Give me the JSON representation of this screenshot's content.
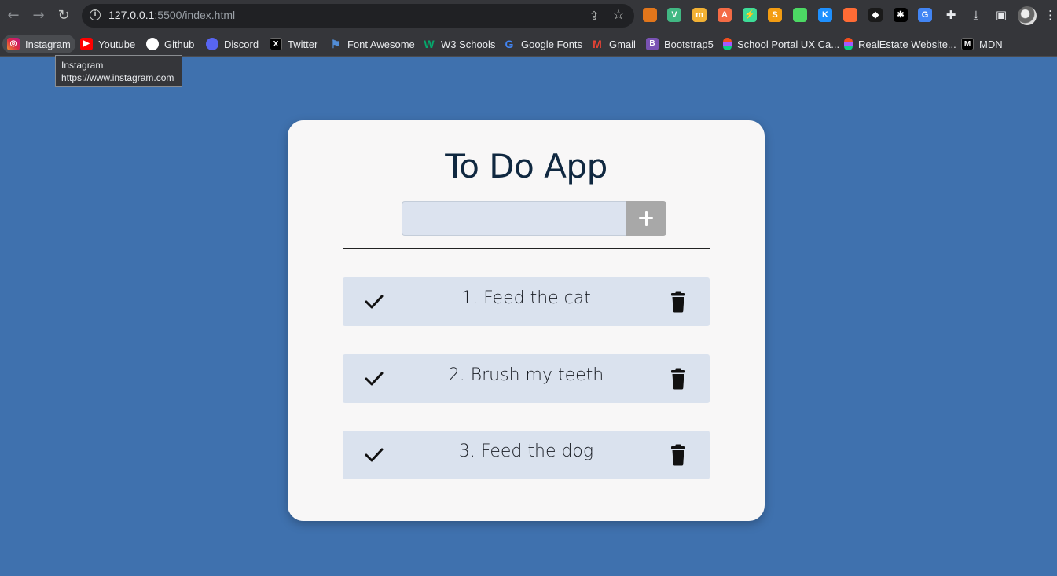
{
  "browser": {
    "url_host": "127.0.0.1",
    "url_rest": ":5500/index.html",
    "nav": {
      "back_icon": "←",
      "forward_icon": "→",
      "reload_icon": "↻"
    },
    "extensions": [
      {
        "name": "metamask-icon",
        "glyph": "",
        "color": "#e2761b"
      },
      {
        "name": "vue-devtools-icon",
        "glyph": "V",
        "color": "#41b883"
      },
      {
        "name": "extension-yellow-icon",
        "glyph": "m",
        "color": "#f2b134"
      },
      {
        "name": "extension-a-icon",
        "glyph": "A",
        "color": "#f46b45"
      },
      {
        "name": "extension-bolt-icon",
        "glyph": "⚡",
        "color": "#3ddc97"
      },
      {
        "name": "extension-s-icon",
        "glyph": "S",
        "color": "#f39c12"
      },
      {
        "name": "extension-frog-icon",
        "glyph": "",
        "color": "#4cd964"
      },
      {
        "name": "extension-k-icon",
        "glyph": "K",
        "color": "#1e90ff"
      },
      {
        "name": "extension-fox-icon",
        "glyph": "",
        "color": "#ff6b35"
      },
      {
        "name": "extension-diamond-icon",
        "glyph": "◆",
        "color": "#1a1a1a"
      },
      {
        "name": "extension-x-icon",
        "glyph": "✱",
        "color": "#000000"
      },
      {
        "name": "google-translate-icon",
        "glyph": "G",
        "color": "#4285f4"
      }
    ],
    "bookmarks": [
      {
        "name": "bookmark-instagram",
        "label": "Instagram",
        "icon": "instagram-icon",
        "color": "#e1306c",
        "glyph": "◎"
      },
      {
        "name": "bookmark-youtube",
        "label": "Youtube",
        "icon": "youtube-icon",
        "color": "#ff0000",
        "glyph": "▶"
      },
      {
        "name": "bookmark-github",
        "label": "Github",
        "icon": "github-icon",
        "color": "#ffffff",
        "glyph": ""
      },
      {
        "name": "bookmark-discord",
        "label": "Discord",
        "icon": "discord-icon",
        "color": "#5865f2",
        "glyph": ""
      },
      {
        "name": "bookmark-twitter",
        "label": "Twitter",
        "icon": "x-icon",
        "color": "#000000",
        "glyph": "X"
      },
      {
        "name": "bookmark-font-awesome",
        "label": "Font Awesome",
        "icon": "flag-icon",
        "color": "#528dd7",
        "glyph": "⚑"
      },
      {
        "name": "bookmark-w3-schools",
        "label": "W3 Schools",
        "icon": "w3schools-icon",
        "color": "#04aa6d",
        "glyph": "W"
      },
      {
        "name": "bookmark-google-fonts",
        "label": "Google Fonts",
        "icon": "google-fonts-icon",
        "color": "#4285f4",
        "glyph": "G"
      },
      {
        "name": "bookmark-gmail",
        "label": "Gmail",
        "icon": "gmail-icon",
        "color": "#ea4335",
        "glyph": "M"
      },
      {
        "name": "bookmark-bootstrap5",
        "label": "Bootstrap5",
        "icon": "bootstrap-icon",
        "color": "#7952b3",
        "glyph": "B"
      },
      {
        "name": "bookmark-school-portal",
        "label": "School Portal UX Ca...",
        "icon": "figma-icon",
        "color": "#f24e1e",
        "glyph": ""
      },
      {
        "name": "bookmark-realestate",
        "label": "RealEstate Website...",
        "icon": "figma-icon",
        "color": "#f24e1e",
        "glyph": ""
      },
      {
        "name": "bookmark-mdn",
        "label": "MDN",
        "icon": "mdn-icon",
        "color": "#000000",
        "glyph": "M"
      }
    ],
    "tooltip": {
      "title": "Instagram",
      "url": "https://www.instagram.com"
    }
  },
  "app": {
    "title": "To Do App",
    "input": {
      "value": "",
      "placeholder": ""
    },
    "add_button_icon": "plus-icon",
    "todos": [
      {
        "text": "1. Feed the cat"
      },
      {
        "text": "2. Brush my teeth"
      },
      {
        "text": "3. Feed the dog"
      }
    ]
  }
}
